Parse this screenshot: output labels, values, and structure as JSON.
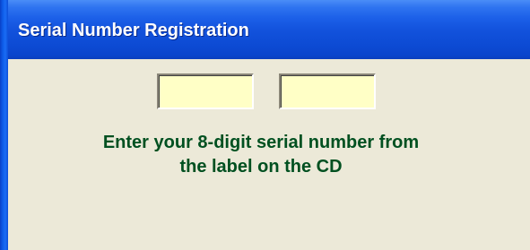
{
  "window": {
    "title": "Serial Number Registration"
  },
  "form": {
    "field_1_value": "",
    "field_2_value": "",
    "instruction_line_1": "Enter your 8-digit serial number from",
    "instruction_line_2": "the label on the CD"
  },
  "colors": {
    "titlebar": "#0d4bd4",
    "client_background": "#ece9d8",
    "field_background": "#ffffc6",
    "instruction_text": "#005020"
  }
}
